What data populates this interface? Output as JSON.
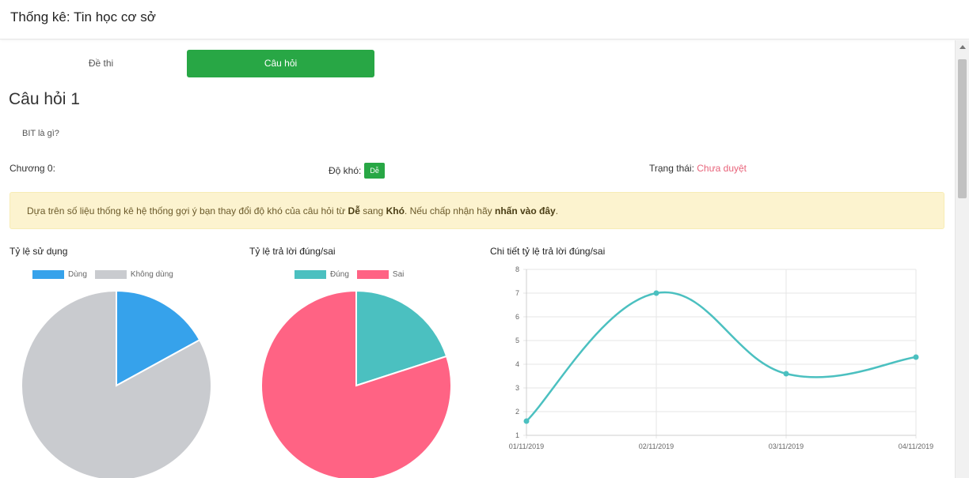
{
  "header": {
    "title": "Thống kê: Tin học cơ sở"
  },
  "tabs": [
    {
      "label": "Đề thi",
      "active": false
    },
    {
      "label": "Câu hỏi",
      "active": true
    }
  ],
  "question": {
    "title": "Câu hỏi 1",
    "text": "BIT là gì?",
    "chapter_label": "Chương 0:",
    "difficulty_label": "Độ khó:",
    "difficulty_value": "Dễ",
    "status_label": "Trạng thái:",
    "status_value": "Chưa duyệt"
  },
  "alert": {
    "part1": "Dựa trên số liệu thống kê hệ thống gợi ý bạn thay đổi độ khó của câu hỏi từ ",
    "from": "Dễ",
    "part2": " sang ",
    "to": "Khó",
    "part3": ". Nếu chấp nhận hãy ",
    "link": "nhấn vào đây",
    "part4": "."
  },
  "colors": {
    "accent_green": "#28a745",
    "blue": "#36a2eb",
    "grey": "#c9cbcf",
    "teal": "#4bc0c0",
    "red": "#ff6384",
    "status_pink": "#e8637a",
    "alert_bg": "#fcf3cf"
  },
  "chart_data": [
    {
      "type": "pie",
      "title": "Tỷ lệ sử dụng",
      "labels": [
        "Dùng",
        "Không dùng"
      ],
      "values": [
        17,
        83
      ],
      "colors": [
        "#36a2eb",
        "#c9cbcf"
      ],
      "legend": "top"
    },
    {
      "type": "pie",
      "title": "Tỷ lệ trả lời đúng/sai",
      "labels": [
        "Đúng",
        "Sai"
      ],
      "values": [
        20,
        80
      ],
      "colors": [
        "#4bc0c0",
        "#ff6384"
      ],
      "legend": "top"
    },
    {
      "type": "line",
      "title": "Chi tiết tỷ lệ trả lời đúng/sai",
      "x": [
        "01/11/2019",
        "02/11/2019",
        "03/11/2019",
        "04/11/2019"
      ],
      "y": [
        1.6,
        7,
        3.6,
        4.3
      ],
      "ylim": [
        1,
        8
      ],
      "yticks": [
        1,
        2,
        3,
        4,
        5,
        6,
        7,
        8
      ],
      "color": "#4bc0c0",
      "grid": true
    }
  ]
}
